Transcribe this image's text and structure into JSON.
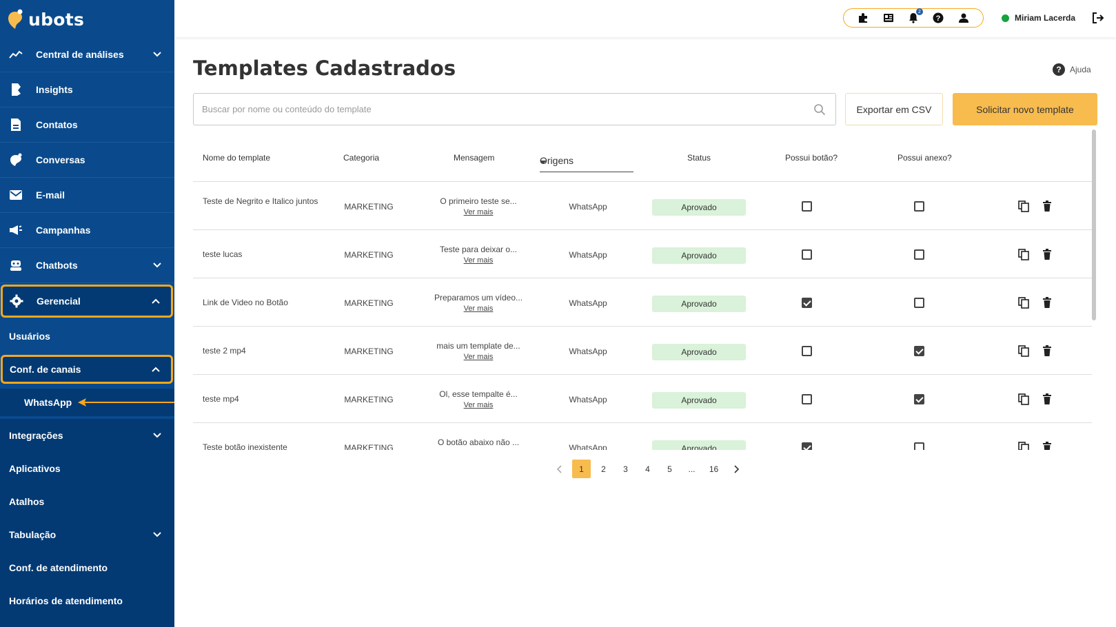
{
  "brand": {
    "name": "ubots"
  },
  "sidebar": {
    "items": [
      {
        "label": "Central de análises",
        "icon": "analytics-icon",
        "expandable": true
      },
      {
        "label": "Insights",
        "icon": "insights-icon",
        "expandable": false
      },
      {
        "label": "Contatos",
        "icon": "contacts-icon",
        "expandable": false
      },
      {
        "label": "Conversas",
        "icon": "conversations-icon",
        "expandable": false
      },
      {
        "label": "E-mail",
        "icon": "email-icon",
        "expandable": false
      },
      {
        "label": "Campanhas",
        "icon": "megaphone-icon",
        "expandable": false
      },
      {
        "label": "Chatbots",
        "icon": "robot-icon",
        "expandable": true
      },
      {
        "label": "Gerencial",
        "icon": "gear-icon",
        "expandable": true,
        "active": true
      }
    ],
    "gerencial_sub": [
      {
        "label": "Usuários"
      },
      {
        "label": "Conf. de canais",
        "active": true
      },
      {
        "label": "WhatsApp"
      },
      {
        "label": "Integrações"
      },
      {
        "label": "Aplicativos"
      },
      {
        "label": "Atalhos"
      },
      {
        "label": "Tabulação"
      },
      {
        "label": "Conf. de atendimento"
      },
      {
        "label": "Horários de atendimento"
      }
    ]
  },
  "topbar": {
    "icons": [
      "puzzle-icon",
      "newspaper-icon",
      "bell-icon",
      "help-icon",
      "user-icon"
    ],
    "notification_count": "2",
    "user_name": "Miriam Lacerda",
    "status_color": "#15a33c"
  },
  "main": {
    "title": "Templates Cadastrados",
    "help_label": "Ajuda",
    "search_placeholder": "Buscar por nome ou conteúdo do template",
    "export_label": "Exportar em CSV",
    "new_label": "Solicitar novo template"
  },
  "table": {
    "headers": {
      "name": "Nome do template",
      "category": "Categoria",
      "message": "Mensagem",
      "origins": "Origens",
      "status": "Status",
      "has_button": "Possui botão?",
      "has_attachment": "Possui anexo?"
    },
    "see_more": "Ver mais",
    "rows": [
      {
        "name": "Teste de Negrito e Italico juntos",
        "category": "MARKETING",
        "message": "O primeiro teste se...",
        "origin": "WhatsApp",
        "status": "Aprovado",
        "button": false,
        "attachment": false
      },
      {
        "name": "teste lucas",
        "category": "MARKETING",
        "message": "Teste para deixar o...",
        "origin": "WhatsApp",
        "status": "Aprovado",
        "button": false,
        "attachment": false
      },
      {
        "name": "Link de Video no Botão",
        "category": "MARKETING",
        "message": "Preparamos um vídeo...",
        "origin": "WhatsApp",
        "status": "Aprovado",
        "button": true,
        "attachment": false
      },
      {
        "name": "teste 2 mp4",
        "category": "MARKETING",
        "message": "mais um template de...",
        "origin": "WhatsApp",
        "status": "Aprovado",
        "button": false,
        "attachment": true
      },
      {
        "name": "teste mp4",
        "category": "MARKETING",
        "message": "Ol, esse tempalte é...",
        "origin": "WhatsApp",
        "status": "Aprovado",
        "button": false,
        "attachment": true
      },
      {
        "name": "Teste botão inexistente",
        "category": "MARKETING",
        "message": "O botão abaixo não ...",
        "origin": "WhatsApp",
        "status": "Aprovado",
        "button": true,
        "attachment": false
      }
    ]
  },
  "pagination": {
    "pages": [
      "1",
      "2",
      "3",
      "4",
      "5",
      "...",
      "16"
    ],
    "current": "1"
  },
  "colors": {
    "sidebar": "#0a4a8c",
    "accent": "#f6a81c",
    "primary_button": "#f8bb4e",
    "approved_bg": "#d9f2d9"
  }
}
